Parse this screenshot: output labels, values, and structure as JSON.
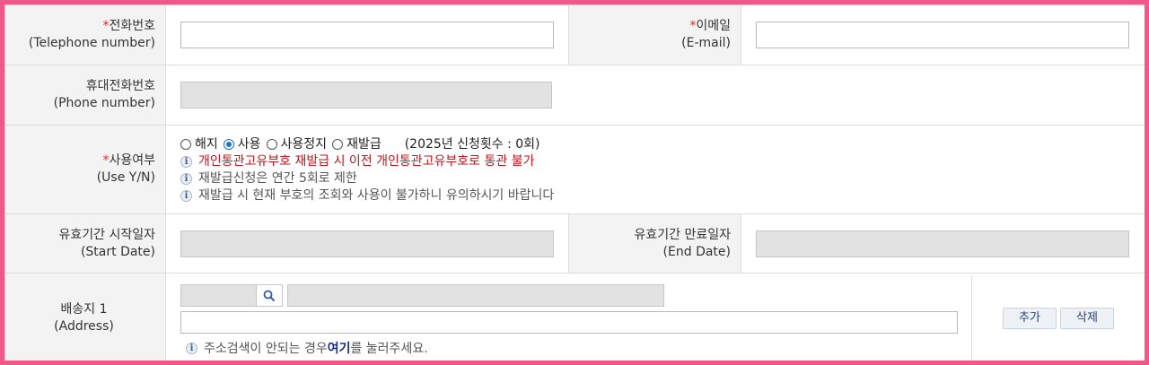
{
  "fields": {
    "telephone": {
      "label_ko": "전화번호",
      "label_en": "(Telephone number)",
      "required": "*",
      "value": ""
    },
    "email": {
      "label_ko": "이메일",
      "label_en": "(E-mail)",
      "required": "*",
      "value": ""
    },
    "mobile": {
      "label_ko": "휴대전화번호",
      "label_en": "(Phone number)",
      "value": ""
    },
    "use_yn": {
      "label_ko": "사용여부",
      "label_en": "(Use Y/N)",
      "required": "*",
      "options": [
        "해지",
        "사용",
        "사용정지",
        "재발급"
      ],
      "selected": "사용",
      "count_text": "(2025년 신청횟수 : 0회)",
      "notices": [
        "개인통관고유부호 재발급 시 이전 개인통관고유부호로 통관 불가",
        "재발급신청은 연간 5회로 제한",
        "재발급 시 현재 부호의 조회와 사용이 불가하니 유의하시기 바랍니다"
      ]
    },
    "start_date": {
      "label_ko": "유효기간 시작일자",
      "label_en": "(Start Date)",
      "value": ""
    },
    "end_date": {
      "label_ko": "유효기간 만료일자",
      "label_en": "(End Date)",
      "value": ""
    },
    "address": {
      "label_ko": "배송지 1",
      "label_en": "(Address)",
      "hint_before": "주소검색이 안되는 경우 ",
      "hint_link": "여기",
      "hint_after": "를 눌러주세요.",
      "add_button": "추가",
      "delete_button": "삭제"
    }
  },
  "colors": {
    "frame": "#f0588a",
    "label_bg": "#f3f3f3",
    "required": "#e02a2a",
    "notice_red": "#c0151d",
    "link": "#1c2e86"
  },
  "icons": {
    "info": "info-icon",
    "search": "search-icon"
  }
}
